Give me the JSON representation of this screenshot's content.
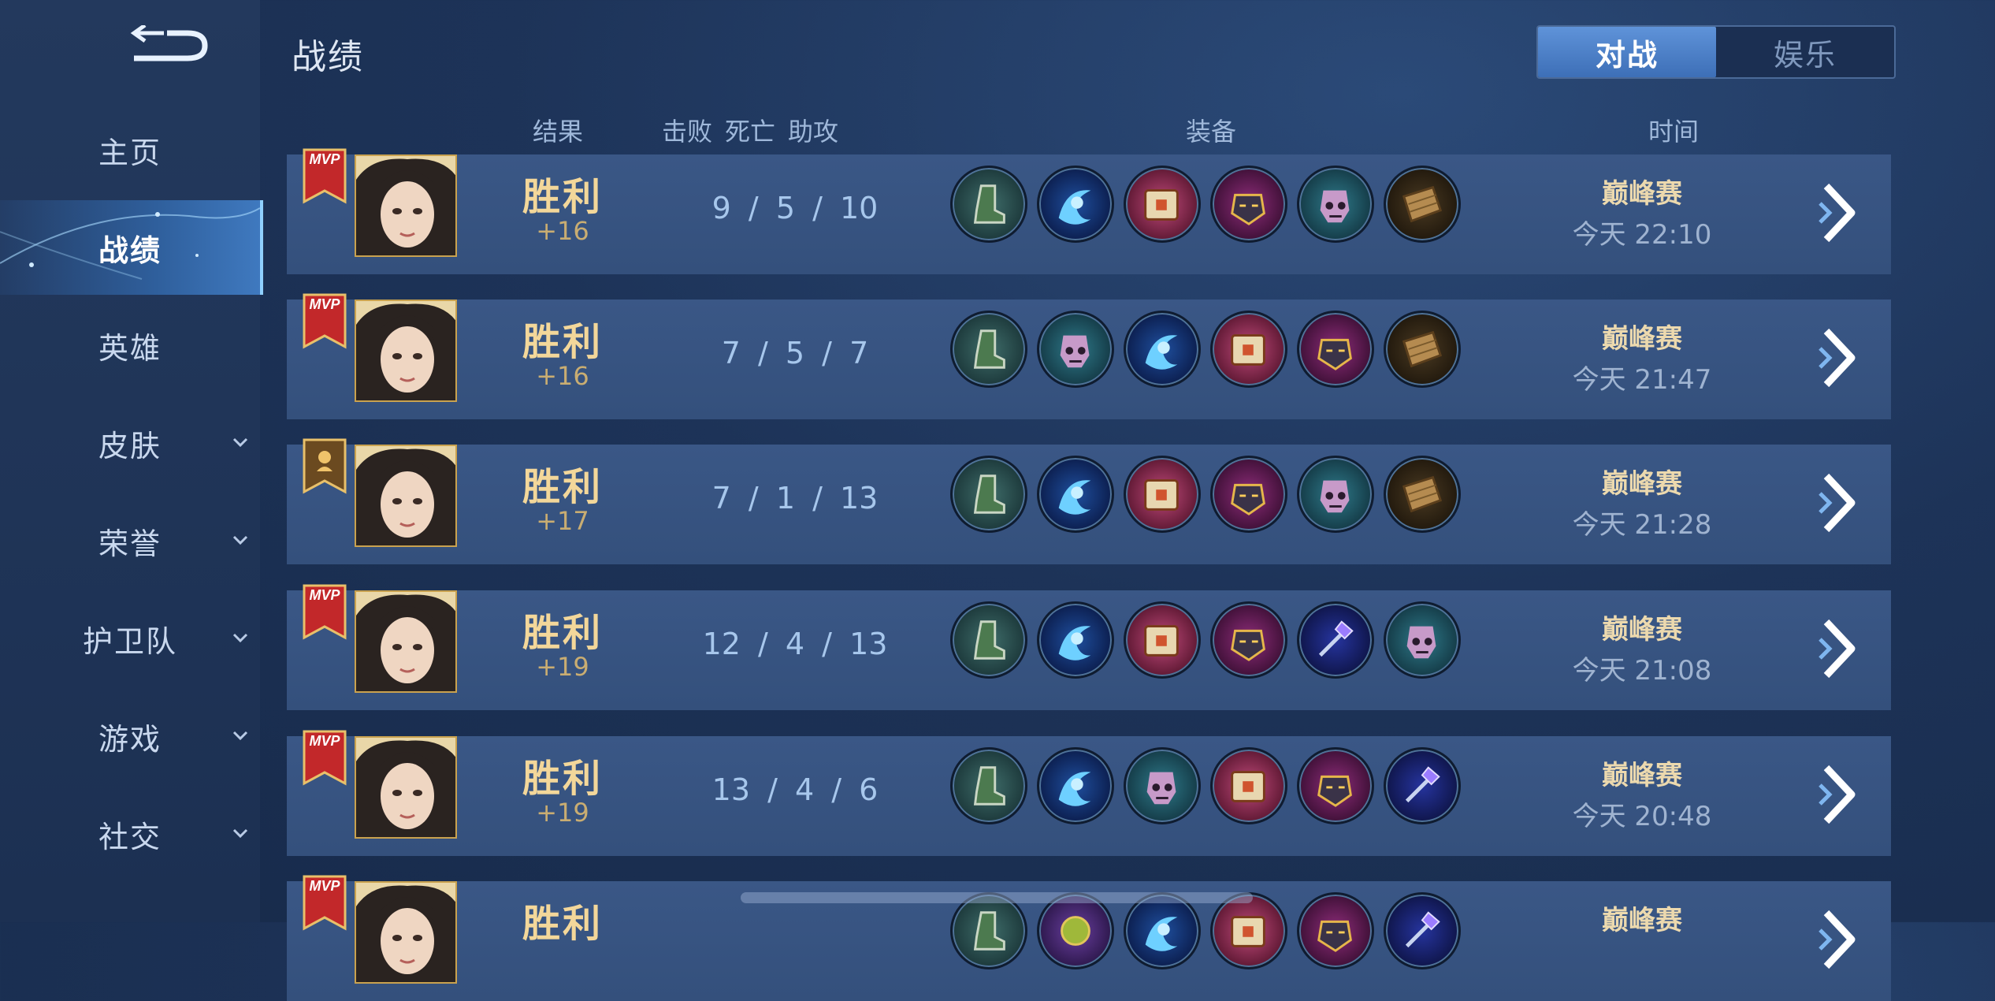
{
  "page": {
    "title": "战绩"
  },
  "sidebar": {
    "items": [
      {
        "label": "主页",
        "expandable": false,
        "active": false
      },
      {
        "label": "战绩",
        "expandable": false,
        "active": true
      },
      {
        "label": "英雄",
        "expandable": false,
        "active": false
      },
      {
        "label": "皮肤",
        "expandable": true,
        "active": false
      },
      {
        "label": "荣誉",
        "expandable": true,
        "active": false
      },
      {
        "label": "护卫队",
        "expandable": true,
        "active": false
      },
      {
        "label": "游戏",
        "expandable": true,
        "active": false
      },
      {
        "label": "社交",
        "expandable": true,
        "active": false
      }
    ]
  },
  "tabs": [
    {
      "label": "对战",
      "active": true
    },
    {
      "label": "娱乐",
      "active": false
    }
  ],
  "columns": {
    "result": "结果",
    "kills": "击败",
    "deaths": "死亡",
    "assists": "助攻",
    "items": "装备",
    "time": "时间"
  },
  "badge_text": "MVP",
  "matches": [
    {
      "badge": "mvp",
      "result": "胜利",
      "points": "+16",
      "kills": "9",
      "deaths": "5",
      "assists": "10",
      "items": [
        "boots",
        "blue-orb",
        "pink-book",
        "purple-mask",
        "skull-helm",
        "wooden-board"
      ],
      "mode": "巅峰赛",
      "time": "今天 22:10"
    },
    {
      "badge": "mvp",
      "result": "胜利",
      "points": "+16",
      "kills": "7",
      "deaths": "5",
      "assists": "7",
      "items": [
        "boots",
        "skull-helm",
        "blue-orb",
        "pink-book",
        "purple-mask",
        "wooden-board"
      ],
      "mode": "巅峰赛",
      "time": "今天 21:47"
    },
    {
      "badge": "hero",
      "result": "胜利",
      "points": "+17",
      "kills": "7",
      "deaths": "1",
      "assists": "13",
      "items": [
        "boots",
        "blue-orb",
        "pink-book",
        "purple-mask",
        "skull-helm",
        "wooden-board"
      ],
      "mode": "巅峰赛",
      "time": "今天 21:28"
    },
    {
      "badge": "mvp",
      "result": "胜利",
      "points": "+19",
      "kills": "12",
      "deaths": "4",
      "assists": "13",
      "items": [
        "boots",
        "blue-orb",
        "pink-book",
        "purple-mask",
        "crystal-staff",
        "skull-helm"
      ],
      "mode": "巅峰赛",
      "time": "今天 21:08"
    },
    {
      "badge": "mvp",
      "result": "胜利",
      "points": "+19",
      "kills": "13",
      "deaths": "4",
      "assists": "6",
      "items": [
        "boots",
        "blue-orb",
        "skull-helm",
        "pink-book",
        "purple-mask",
        "crystal-staff"
      ],
      "mode": "巅峰赛",
      "time": "今天 20:48"
    },
    {
      "badge": "mvp",
      "result": "胜利",
      "points": "",
      "kills": "",
      "deaths": "",
      "assists": "",
      "items": [
        "boots",
        "green-gold",
        "blue-orb",
        "pink-book",
        "purple-mask",
        "crystal-staff"
      ],
      "mode": "巅峰赛",
      "time": ""
    }
  ],
  "colors": {
    "accent": "#3d6fb7",
    "gold": "#f3d79a",
    "row_bg": "#34507c"
  }
}
